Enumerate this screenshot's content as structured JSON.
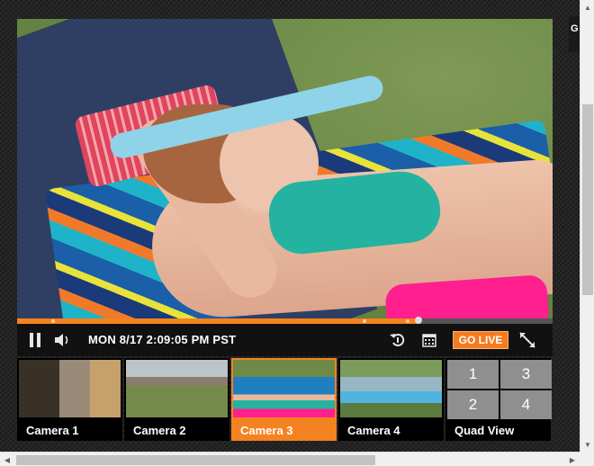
{
  "player": {
    "timestamp": "MON 8/17 2:09:05 PM PST",
    "go_live_label": "GO LIVE",
    "progress_fraction": 0.75,
    "accent_color": "#f58220",
    "icons": [
      "pause-icon",
      "volume-icon",
      "rewind-icon",
      "calendar-icon",
      "fullscreen-expand-icon"
    ]
  },
  "side_tab": {
    "label": "G"
  },
  "cameras": [
    {
      "label": "Camera 1",
      "active": false
    },
    {
      "label": "Camera 2",
      "active": false
    },
    {
      "label": "Camera 3",
      "active": true
    },
    {
      "label": "Camera 4",
      "active": false
    }
  ],
  "quad": {
    "label": "Quad View",
    "cells": [
      "1",
      "3",
      "2",
      "4"
    ]
  }
}
